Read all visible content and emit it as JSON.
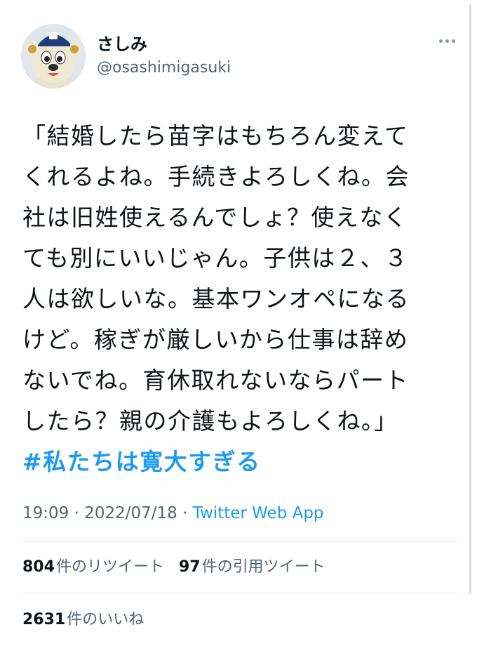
{
  "tweet": {
    "author": {
      "display_name": "さしみ",
      "handle": "@osashimigasuki",
      "avatar_icon": "mascot-avatar-icon"
    },
    "more_icon": "more-horizontal-icon",
    "text": "「結婚したら苗字はもちろん変えて\nくれるよね。手続きよろしくね。会\n社は旧姓使えるんでしょ？使えなく\nても別にいいじゃん。子供は２、３\n人は欲しいな。基本ワンオペになる\nけど。稼ぎが厳しいから仕事は辞め\nないでね。育休取れないならパート\nしたら？親の介護もよろしくね。」",
    "hashtag": "#私たちは寛大すぎる",
    "time": "19:09",
    "date": "2022/07/18",
    "separator": "·",
    "source": "Twitter Web App",
    "retweets": {
      "count": "804",
      "label": "件のリツイート"
    },
    "quotes": {
      "count": "97",
      "label": "件の引用ツイート"
    },
    "likes": {
      "count": "2631",
      "label": "件のいいね"
    }
  },
  "colors": {
    "accent": "#1d9bf0",
    "text": "#0f1419",
    "secondary": "#536471",
    "divider": "#e6ecf0"
  }
}
